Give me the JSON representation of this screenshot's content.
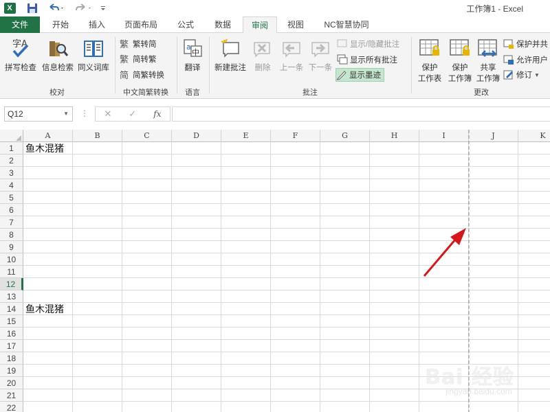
{
  "window": {
    "title": "工作簿1 - Excel"
  },
  "quick_access": {
    "app_icon_letter": "X"
  },
  "tabs": [
    {
      "id": "file",
      "label": "文件"
    },
    {
      "id": "home",
      "label": "开始"
    },
    {
      "id": "insert",
      "label": "插入"
    },
    {
      "id": "page_layout",
      "label": "页面布局"
    },
    {
      "id": "formulas",
      "label": "公式"
    },
    {
      "id": "data",
      "label": "数据"
    },
    {
      "id": "review",
      "label": "审阅",
      "active": true
    },
    {
      "id": "view",
      "label": "视图"
    },
    {
      "id": "nc",
      "label": "NC智慧协同"
    }
  ],
  "ribbon": {
    "proofing": {
      "label": "校对",
      "spell": "拼写检查",
      "research": "信息检索",
      "thesaurus": "同义词库"
    },
    "chinese": {
      "label": "中文简繁转换",
      "to_simplified": "繁转简",
      "to_traditional": "简转繁",
      "convert": "简繁转换"
    },
    "language": {
      "label": "语言",
      "translate": "翻译"
    },
    "comments": {
      "label": "批注",
      "new": "新建批注",
      "delete": "删除",
      "previous": "上一条",
      "next": "下一条",
      "show_hide": "显示/隐藏批注",
      "show_all": "显示所有批注",
      "show_ink": "显示墨迹"
    },
    "changes": {
      "label": "更改",
      "protect_sheet_1": "保护",
      "protect_sheet_2": "工作表",
      "protect_workbook_1": "保护",
      "protect_workbook_2": "工作簿",
      "share_workbook_1": "共享",
      "share_workbook_2": "工作簿",
      "protect_share": "保护并共",
      "allow_users": "允许用户",
      "track_changes": "修订"
    }
  },
  "formula_bar": {
    "name_box": "Q12",
    "fx": "fx",
    "value": ""
  },
  "grid": {
    "columns": [
      "A",
      "B",
      "C",
      "D",
      "E",
      "F",
      "G",
      "H",
      "I",
      "J",
      "K"
    ],
    "rows": [
      "1",
      "2",
      "3",
      "4",
      "5",
      "6",
      "7",
      "8",
      "9",
      "10",
      "11",
      "12",
      "13",
      "14",
      "15",
      "16",
      "17",
      "18",
      "19",
      "20",
      "21",
      "22"
    ],
    "selected_row": "12",
    "cells": [
      {
        "ref": "A1",
        "value": "鱼木混猪"
      },
      {
        "ref": "A14",
        "value": "鱼木混猪"
      }
    ]
  },
  "colors": {
    "excel_green": "#217346",
    "annotation_arrow": "#d7161b",
    "page_break": "#8c8c8c"
  },
  "watermark": {
    "main": "Bai 经验",
    "sub": "jingyan.baidu.com"
  }
}
